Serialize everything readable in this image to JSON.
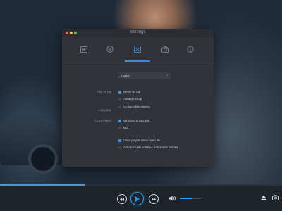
{
  "window": {
    "title": "Settings"
  },
  "tabs": [
    {
      "icon": "list-icon"
    },
    {
      "icon": "add-circle-icon"
    },
    {
      "icon": "subtitle-icon",
      "active": true
    },
    {
      "icon": "camera-icon"
    },
    {
      "icon": "info-icon"
    }
  ],
  "general": {
    "language": {
      "label": "Language",
      "value": "English"
    },
    "play_on_top": {
      "label": "Play on top",
      "options": [
        "Never on top",
        "Always on top",
        "On top while playing"
      ],
      "selected": 0
    },
    "close_player": {
      "label": "Close Player",
      "options": [
        "Minimize to tray Exit",
        "Exit"
      ],
      "selected": 0
    },
    "checkboxes": [
      {
        "label": "Clear playlist when open file",
        "checked": true
      },
      {
        "label": "Automatically add files with similar names",
        "checked": false
      }
    ]
  },
  "player": {
    "progress": 0.3,
    "volume": 0.55
  },
  "colors": {
    "accent": "#2d98f0",
    "panel": "#313338",
    "control_bar": "#1e2429"
  }
}
